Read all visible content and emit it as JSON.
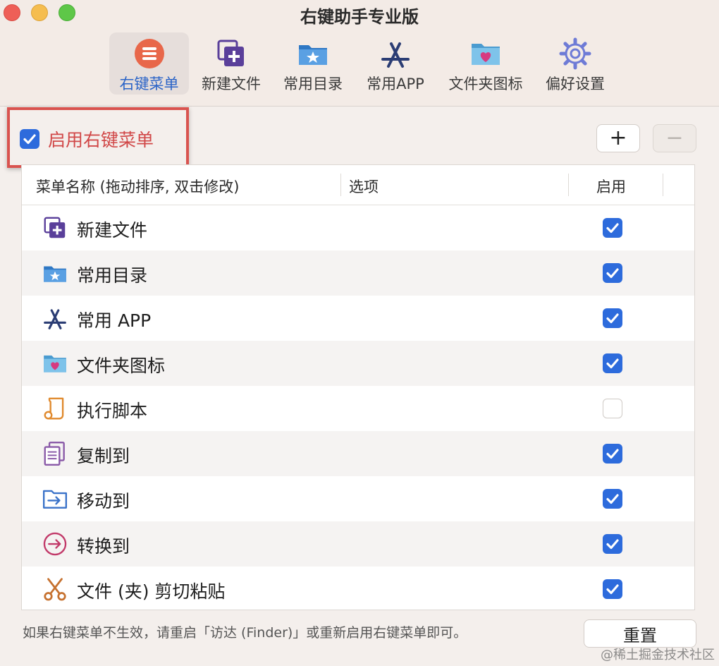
{
  "window": {
    "title": "右键助手专业版"
  },
  "toolbar": {
    "items": [
      {
        "label": "右键菜单",
        "icon": "context-menu-icon",
        "active": true
      },
      {
        "label": "新建文件",
        "icon": "new-file-icon"
      },
      {
        "label": "常用目录",
        "icon": "favorite-folder-icon"
      },
      {
        "label": "常用APP",
        "icon": "app-store-icon"
      },
      {
        "label": "文件夹图标",
        "icon": "folder-heart-icon"
      },
      {
        "label": "偏好设置",
        "icon": "gear-icon"
      }
    ]
  },
  "enable": {
    "label": "启用右键菜单",
    "checked": true
  },
  "buttons": {
    "add": "+",
    "remove": "−",
    "reset": "重置"
  },
  "table": {
    "headers": {
      "name": "菜单名称 (拖动排序, 双击修改)",
      "options": "选项",
      "enabled": "启用"
    },
    "rows": [
      {
        "label": "新建文件",
        "icon": "new-file-icon",
        "enabled": true
      },
      {
        "label": "常用目录",
        "icon": "favorite-folder-icon",
        "enabled": true
      },
      {
        "label": "常用 APP",
        "icon": "app-store-icon",
        "enabled": true
      },
      {
        "label": "文件夹图标",
        "icon": "folder-heart-icon",
        "enabled": true
      },
      {
        "label": "执行脚本",
        "icon": "script-scroll-icon",
        "enabled": false
      },
      {
        "label": "复制到",
        "icon": "copy-document-icon",
        "enabled": true
      },
      {
        "label": "移动到",
        "icon": "move-folder-icon",
        "enabled": true
      },
      {
        "label": "转换到",
        "icon": "convert-arrow-icon",
        "enabled": true
      },
      {
        "label": "文件 (夹) 剪切粘贴",
        "icon": "scissors-icon",
        "enabled": true
      }
    ]
  },
  "footer": {
    "note": "如果右键菜单不生效，请重启「访达 (Finder)」或重新启用右键菜单即可。"
  },
  "watermark": "@稀土掘金技术社区",
  "colors": {
    "accent": "#2d6bdc",
    "highlight": "#d9534f",
    "enable_text": "#d14848"
  }
}
